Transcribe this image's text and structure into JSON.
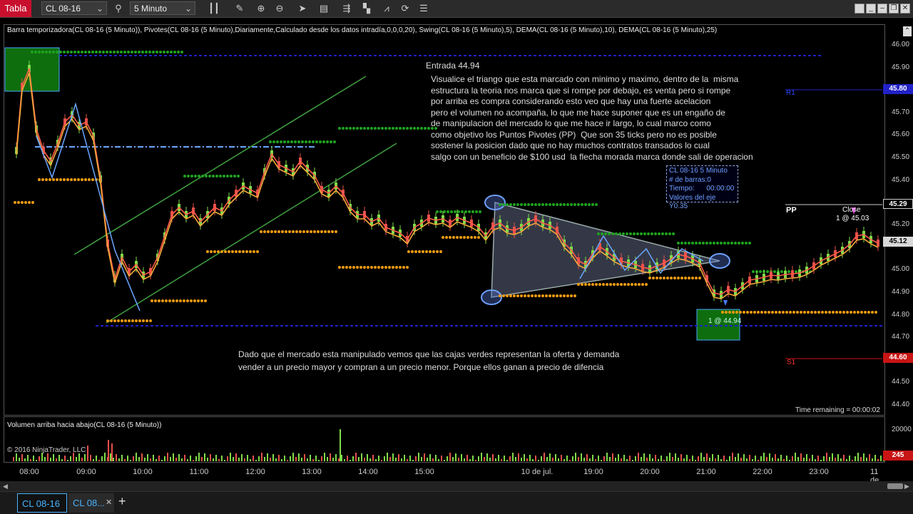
{
  "toolbar": {
    "tabla_label": "Tabla",
    "instrument": "CL 08-16",
    "interval": "5 Minuto",
    "icons": [
      "search-icon",
      "bar-style-icon",
      "pencil-icon",
      "zoom-in-icon",
      "zoom-out-icon",
      "pointer-icon",
      "properties-icon",
      "strategies-icon",
      "indicators-icon",
      "drawing-tools-icon",
      "reload-icon",
      "menu-icon"
    ]
  },
  "chart": {
    "header": "Barra temporizadora(CL 08-16 (5 Minuto)), Pivotes(CL 08-16 (5 Minuto),Diariamente,Calculado desde los datos intradía,0,0,0,20), Swing(CL 08-16 (5 Minuto),5), DEMA(CL 08-16 (5 Minuto),10), DEMA(CL 08-16 (5 Minuto),25)",
    "entrada_label": "Entrada 44.94",
    "annotation_1": "Visualice el triango que esta marcado con minimo y maximo, dentro de la  misma\nestructura la teoria nos marca que si rompe por debajo, es venta pero si rompe\npor arriba es compra considerando esto veo que hay una fuerte acelacion\npero el volumen no acompaña, lo que me hace suponer que es un engaño de\nde manipulacion del mercado lo que me hace ir largo, lo cual marco como\ncomo objetivo los Puntos Pivotes (PP)  Que son 35 ticks pero no es posible\nsostener la posicion dado que no hay muchos contratos transados lo cual\nsalgo con un beneficio de $100 usd  la flecha morada marca donde sali de operacion",
    "annotation_2": "Dado que el mercado esta manipulado vemos que las cajas verdes representan la oferta y demanda\nvender a un precio mayor y compran a un precio menor. Porque ellos ganan a precio de difencia",
    "info_box": {
      "line1": "CL 08-16 5 Minuto",
      "line2": "# de barras:0",
      "line3": "Tiempo:      00:00:00",
      "line4": "Valores del eje Y0.35"
    },
    "pp_label": "PP",
    "r1_label": "R1",
    "s1_label": "S1",
    "close_label": "Close",
    "close_value": "1 @ 45.03",
    "entry_marker": "1 @ 44.94",
    "time_remaining": "Time remaining = 00:00:02",
    "y_ticks": [
      "46.00",
      "45.90",
      "45.70",
      "45.60",
      "45.50",
      "45.40",
      "45.20",
      "45.10",
      "45.00",
      "44.90",
      "44.80",
      "44.70",
      "44.50",
      "44.40"
    ],
    "tags": {
      "r1": "45.80",
      "pp": "45.29",
      "last": "45.12",
      "s1": "44.60"
    }
  },
  "volume": {
    "header": "Volumen arriba hacia abajo(CL 08-16 (5 Minuto))",
    "copyright": "© 2016 NinjaTrader, LLC",
    "y_tick": "20000",
    "tag": "245"
  },
  "x_ticks": [
    "08:00",
    "09:00",
    "10:00",
    "11:00",
    "12:00",
    "13:00",
    "14:00",
    "15:00",
    "10 de jul.",
    "19:00",
    "20:00",
    "21:00",
    "22:00",
    "23:00",
    "11 de jul."
  ],
  "tabs": [
    {
      "label": "CL 08-16"
    },
    {
      "label": "CL 08..."
    }
  ],
  "colors": {
    "up_candle": "#7fdc4a",
    "down_candle": "#e8504a",
    "dema_fast": "#ff5a4a",
    "dema_slow": "#f4a93a",
    "pivot_green": "#1fa21f",
    "pivot_orange": "#f39c12",
    "level_blue": "#2121c8",
    "accent": "#c8102e"
  }
}
